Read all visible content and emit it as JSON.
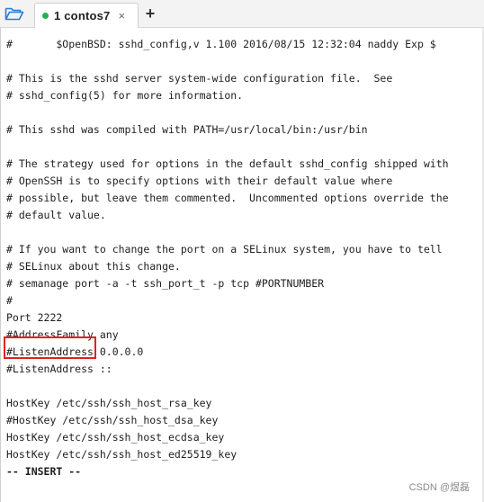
{
  "tabbar": {
    "folder_icon": "folder-open-icon",
    "tab": {
      "label": "1 contos7",
      "status_color": "#22b14c",
      "close_glyph": "×"
    },
    "new_tab_glyph": "+"
  },
  "terminal": {
    "lines": [
      "#       $OpenBSD: sshd_config,v 1.100 2016/08/15 12:32:04 naddy Exp $",
      "",
      "# This is the sshd server system-wide configuration file.  See",
      "# sshd_config(5) for more information.",
      "",
      "# This sshd was compiled with PATH=/usr/local/bin:/usr/bin",
      "",
      "# The strategy used for options in the default sshd_config shipped with",
      "# OpenSSH is to specify options with their default value where",
      "# possible, but leave them commented.  Uncommented options override the",
      "# default value.",
      "",
      "# If you want to change the port on a SELinux system, you have to tell",
      "# SELinux about this change.",
      "# semanage port -a -t ssh_port_t -p tcp #PORTNUMBER",
      "#",
      "Port 2222",
      "#AddressFamily any",
      "#ListenAddress 0.0.0.0",
      "#ListenAddress ::",
      "",
      "HostKey /etc/ssh/ssh_host_rsa_key",
      "#HostKey /etc/ssh/ssh_host_dsa_key",
      "HostKey /etc/ssh/ssh_host_ecdsa_key",
      "HostKey /etc/ssh/ssh_host_ed25519_key",
      "-- INSERT --"
    ],
    "highlight_color": "#e02020"
  },
  "watermark": "CSDN @煜磊"
}
